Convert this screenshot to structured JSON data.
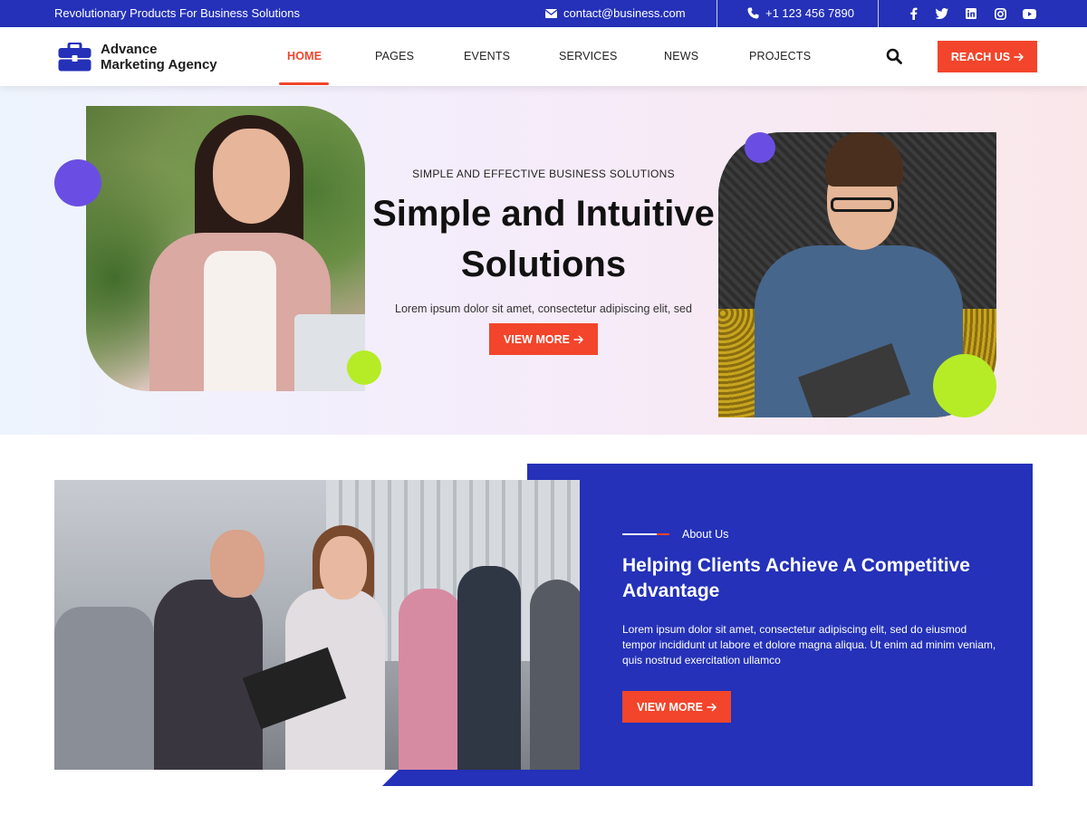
{
  "topbar": {
    "tagline": "Revolutionary Products For Business Solutions",
    "email": "contact@business.com",
    "phone": "+1 123 456 7890",
    "social_icons": [
      "facebook-icon",
      "twitter-icon",
      "linkedin-icon",
      "instagram-icon",
      "youtube-icon"
    ]
  },
  "header": {
    "logo_line1": "Advance",
    "logo_line2": "Marketing Agency",
    "nav": [
      "HOME",
      "PAGES",
      "EVENTS",
      "SERVICES",
      "NEWS",
      "PROJECTS"
    ],
    "active_nav": "HOME",
    "cta_label": "REACH US"
  },
  "hero": {
    "subtitle": "SIMPLE AND EFFECTIVE BUSINESS SOLUTIONS",
    "title_line1": "Simple and Intuitive",
    "title_line2": "Solutions",
    "description": "Lorem ipsum dolor sit amet, consectetur adipiscing elit, sed",
    "button_label": "VIEW MORE"
  },
  "about": {
    "kicker": "About Us",
    "title_line1": "Helping Clients Achieve A Competitive",
    "title_line2": "Advantage",
    "description": "Lorem ipsum dolor sit amet, consectetur adipiscing elit, sed do eiusmod tempor incididunt ut labore et dolore magna aliqua. Ut enim ad minim veniam, quis nostrud exercitation ullamco",
    "button_label": "VIEW MORE"
  },
  "colors": {
    "primary_blue": "#2431b8",
    "accent_orange": "#f2452b",
    "accent_purple": "#6a4ee3",
    "accent_lime": "#b5ec26"
  }
}
